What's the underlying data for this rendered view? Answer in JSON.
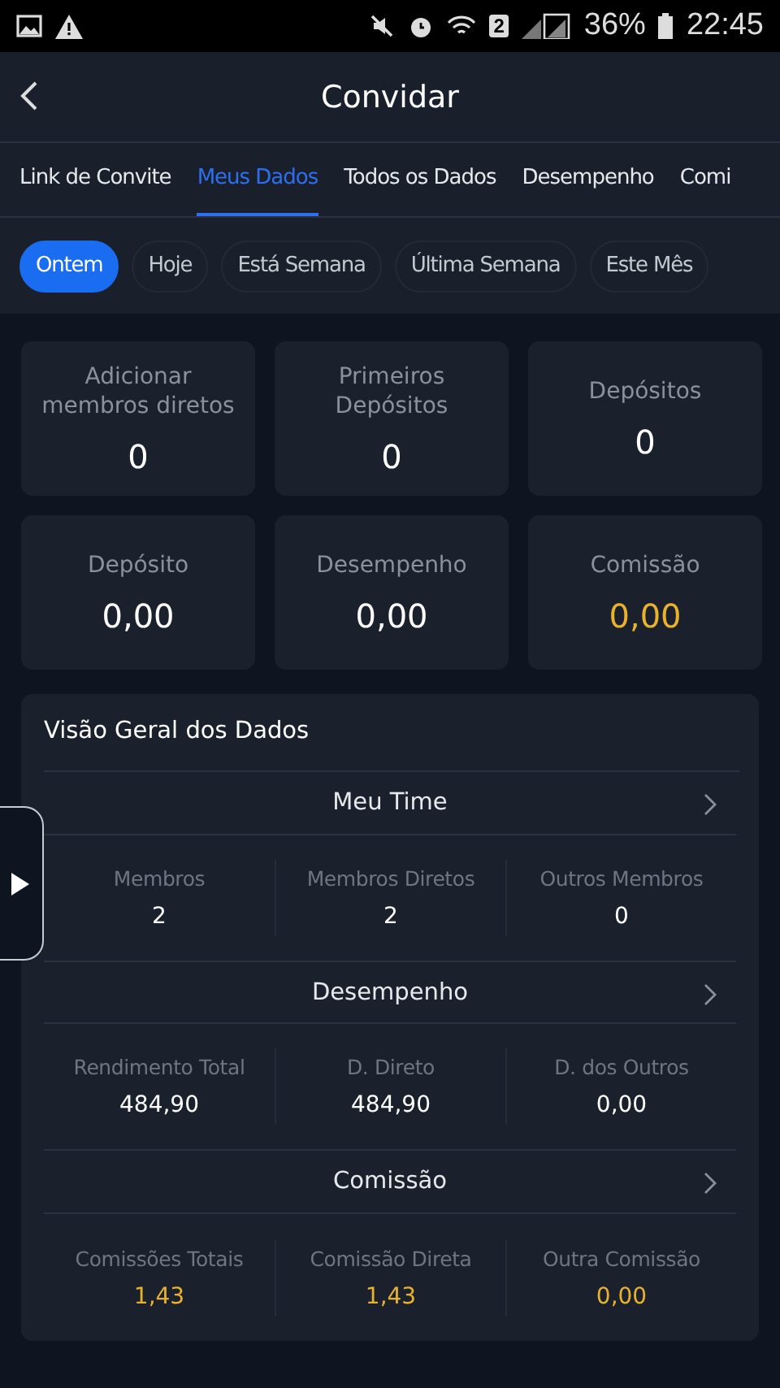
{
  "status_bar": {
    "sim": "2",
    "battery": "36%",
    "time": "22:45"
  },
  "header": {
    "title": "Convidar"
  },
  "tabs": [
    {
      "label": "Link de Convite",
      "selected": false
    },
    {
      "label": "Meus Dados",
      "selected": true
    },
    {
      "label": "Todos os Dados",
      "selected": false
    },
    {
      "label": "Desempenho",
      "selected": false
    },
    {
      "label": "Comi",
      "selected": false
    }
  ],
  "filters": [
    {
      "label": "Ontem",
      "selected": true
    },
    {
      "label": "Hoje",
      "selected": false
    },
    {
      "label": "Está Semana",
      "selected": false
    },
    {
      "label": "Última Semana",
      "selected": false
    },
    {
      "label": "Este Mês",
      "selected": false
    }
  ],
  "summary_cards": [
    {
      "label": "Adicionar membros diretos",
      "value": "0",
      "accent": false
    },
    {
      "label": "Primeiros Depósitos",
      "value": "0",
      "accent": false
    },
    {
      "label": "Depósitos",
      "value": "0",
      "accent": false
    },
    {
      "label": "Depósito",
      "value": "0,00",
      "accent": false
    },
    {
      "label": "Desempenho",
      "value": "0,00",
      "accent": false
    },
    {
      "label": "Comissão",
      "value": "0,00",
      "accent": true
    }
  ],
  "overview": {
    "title": "Visão Geral dos Dados",
    "sections": [
      {
        "title": "Meu Time",
        "stats": [
          {
            "label": "Membros",
            "value": "2",
            "accent": false
          },
          {
            "label": "Membros Diretos",
            "value": "2",
            "accent": false
          },
          {
            "label": "Outros Membros",
            "value": "0",
            "accent": false
          }
        ]
      },
      {
        "title": "Desempenho",
        "stats": [
          {
            "label": "Rendimento Total",
            "value": "484,90",
            "accent": false
          },
          {
            "label": "D. Direto",
            "value": "484,90",
            "accent": false
          },
          {
            "label": "D. dos Outros",
            "value": "0,00",
            "accent": false
          }
        ]
      },
      {
        "title": "Comissão",
        "stats": [
          {
            "label": "Comissões Totais",
            "value": "1,43",
            "accent": true
          },
          {
            "label": "Comissão Direta",
            "value": "1,43",
            "accent": true
          },
          {
            "label": "Outra Comissão",
            "value": "0,00",
            "accent": true
          }
        ]
      }
    ]
  }
}
